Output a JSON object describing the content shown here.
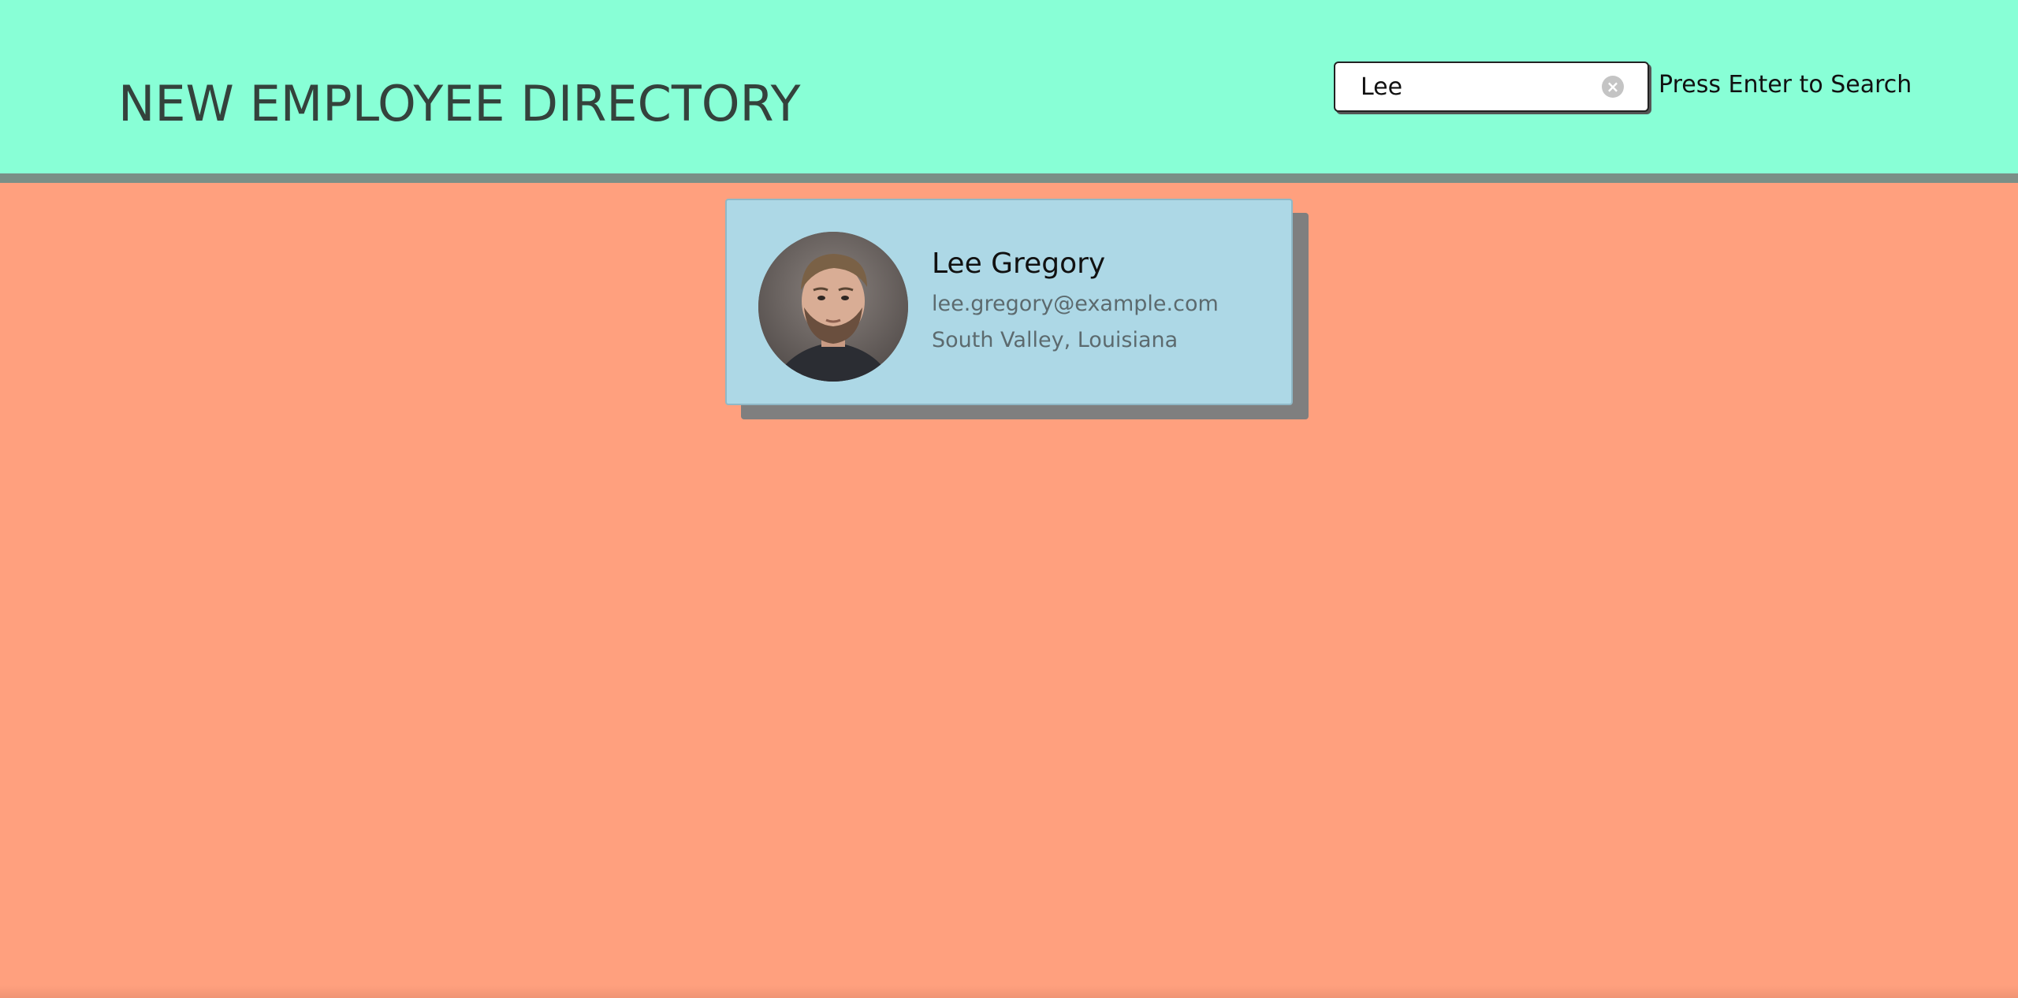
{
  "header": {
    "title": "NEW EMPLOYEE DIRECTORY",
    "background_color": "#88FFD6",
    "border_color": "#7A8F87"
  },
  "search": {
    "value": "Lee",
    "clear_icon": "clear-circle-icon",
    "hint": "Press Enter to Search"
  },
  "results": [
    {
      "name": "Lee Gregory",
      "email": "lee.gregory@example.com",
      "location": "South Valley, Louisiana",
      "avatar": "employee-photo"
    }
  ],
  "colors": {
    "page_background": "#FFA07E",
    "card_background": "#ADD8E6",
    "card_shadow": "#7F7F7F"
  }
}
